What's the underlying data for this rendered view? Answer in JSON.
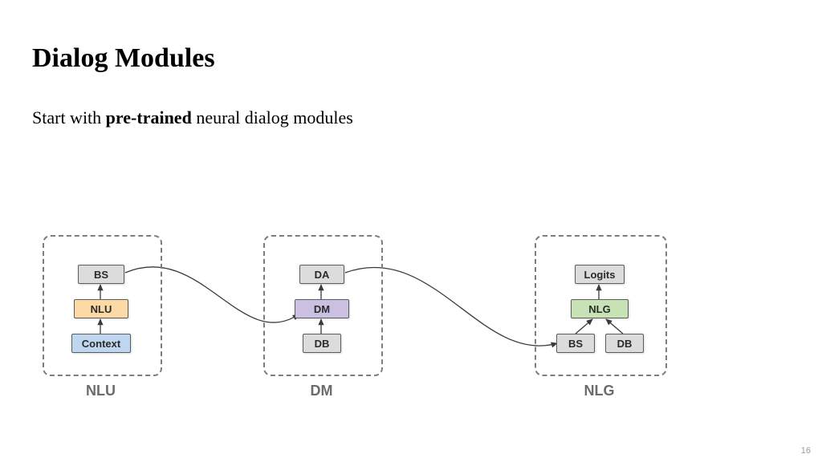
{
  "title": "Dialog Modules",
  "subtitle_lead": "Start with ",
  "subtitle_bold": "pre-trained",
  "subtitle_tail": " neural dialog modules",
  "page_number": "16",
  "modules": {
    "nlu": {
      "label": "NLU",
      "cells": {
        "bs": "BS",
        "nlu": "NLU",
        "context": "Context"
      }
    },
    "dm": {
      "label": "DM",
      "cells": {
        "da": "DA",
        "dm": "DM",
        "db": "DB"
      }
    },
    "nlg": {
      "label": "NLG",
      "cells": {
        "logits": "Logits",
        "nlg": "NLG",
        "bs": "BS",
        "db": "DB"
      }
    }
  }
}
